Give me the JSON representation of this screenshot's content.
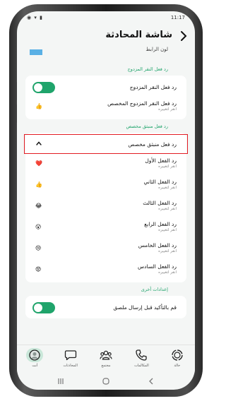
{
  "status": {
    "time": "11:17",
    "icons": "◉ ▾ ▮"
  },
  "header": {
    "title": "شاشة المحادثة"
  },
  "peek": {
    "label": "لون الرابط",
    "swatch_color": "#5ab0e5"
  },
  "double_tap": {
    "section_title": "رد فعل النقر المزدوج",
    "rows": [
      {
        "title": "رد فعل النقر المزدوج"
      },
      {
        "title": "رد فعل النقر المزدوج المخصص",
        "subtitle": "انقر لتغييره",
        "emoji": "👍"
      }
    ]
  },
  "custom_menu": {
    "section_title": "رد فعل منبثق مخصص",
    "header_row": {
      "title": "رد فعل منبثق مخصص"
    },
    "rows": [
      {
        "title": "رد الفعل الأول",
        "subtitle": "انقر لتغييره",
        "emoji": "❤️"
      },
      {
        "title": "رد الفعل الثاني",
        "subtitle": "انقر لتغييره",
        "emoji": "👍"
      },
      {
        "title": "رد الفعل الثالث",
        "subtitle": "انقر لتغييره",
        "emoji": "😂"
      },
      {
        "title": "رد الفعل الرابع",
        "subtitle": "انقر لتغييره",
        "emoji": "😮"
      },
      {
        "title": "رد الفعل الخامس",
        "subtitle": "انقر لتغييره",
        "emoji": "😢"
      },
      {
        "title": "رد الفعل السادس",
        "subtitle": "انقر لتغييره",
        "emoji": "😡"
      }
    ]
  },
  "other": {
    "section_title": "إعدادات أخرى",
    "rows": [
      {
        "title": "قم بالتأكيد قبل إرسال ملصق"
      }
    ]
  },
  "navbar": {
    "items": [
      {
        "label": "أنت",
        "icon": "profile-icon"
      },
      {
        "label": "المحادثات",
        "icon": "chats-icon"
      },
      {
        "label": "مجتمع",
        "icon": "community-icon"
      },
      {
        "label": "المكالمات",
        "icon": "calls-icon"
      },
      {
        "label": "حالة",
        "icon": "status-icon"
      }
    ]
  },
  "colors": {
    "accent": "#1fa46b",
    "highlight": "#e21b23"
  }
}
